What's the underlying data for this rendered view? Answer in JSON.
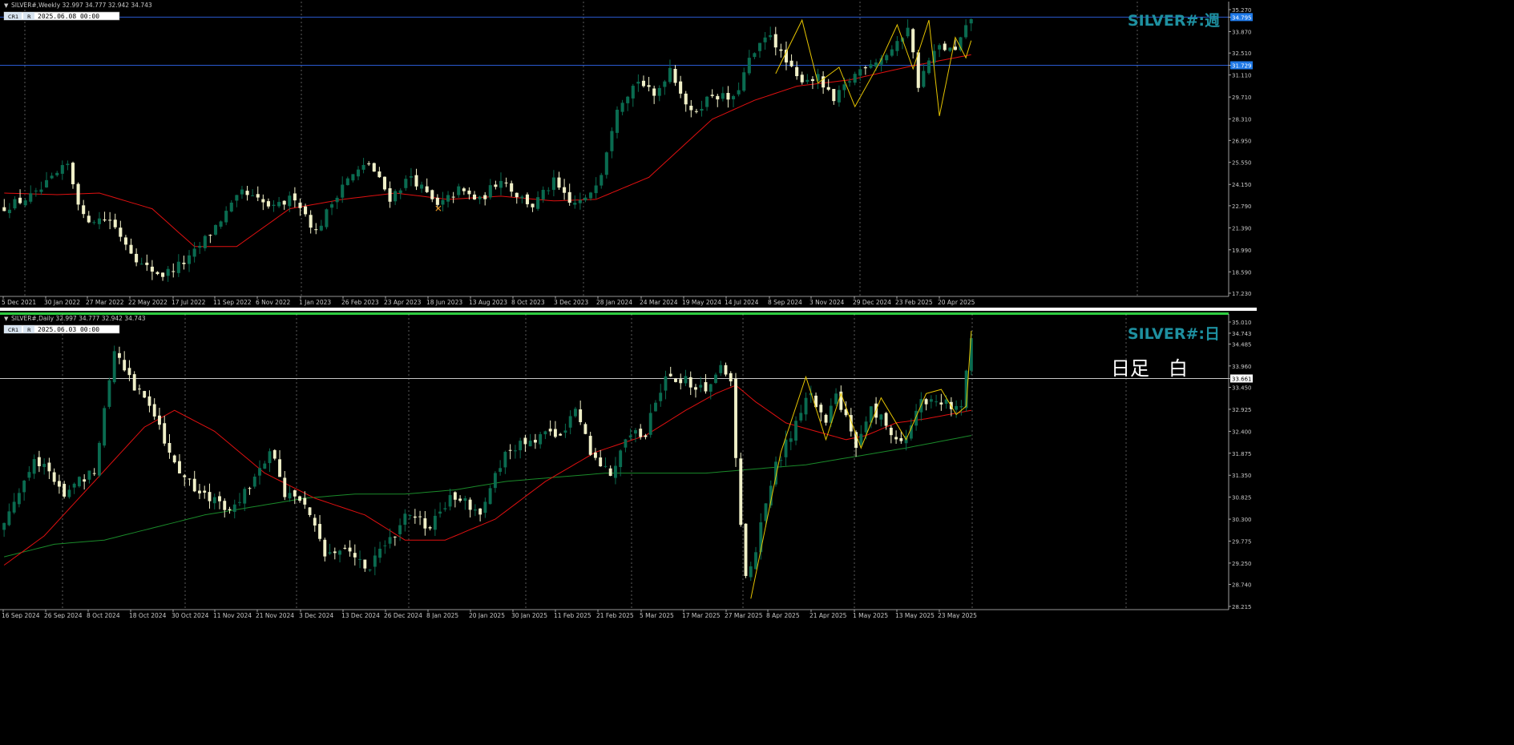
{
  "colors": {
    "background": "#000000",
    "bull_candle": "#0a6b50",
    "bear_candle": "#f0f0c8",
    "ma_short": "#e01010",
    "ma_long": "#1a8a2a",
    "zigzag": "#e6c400",
    "title": "#1e90a0",
    "hline_weekly": "#2a5ad0",
    "hline_daily": "#c8c8c8",
    "price_label": "#1e78e6",
    "panel_divider": "#2ecc40",
    "grid": "#c0c0c0",
    "text": "#c8c8c8"
  },
  "chart_data": [
    {
      "type": "candlestick",
      "symbol_header": "SILVER#,Weekly  32.997 34.777 32.942 34.743",
      "title": "SILVER#:週",
      "toolbar": {
        "cr1": "CR1",
        "r": "R",
        "datetime": "2025.06.08 00:00"
      },
      "ylim": [
        17.23,
        35.27
      ],
      "y_ticks": [
        "35.270",
        "34.795",
        "33.870",
        "32.510",
        "31.729",
        "31.110",
        "29.710",
        "28.310",
        "26.950",
        "25.550",
        "24.150",
        "22.790",
        "21.390",
        "19.990",
        "18.590",
        "17.230"
      ],
      "horizontal_lines": [
        {
          "value": 34.795,
          "label": "34.795"
        },
        {
          "value": 31.729,
          "label": "31.729"
        }
      ],
      "current_price": "34.795",
      "x_labels": [
        "5 Dec 2021",
        "30 Jan 2022",
        "27 Mar 2022",
        "22 May 2022",
        "17 Jul 2022",
        "11 Sep 2022",
        "6 Nov 2022",
        "1 Jan 2023",
        "26 Feb 2023",
        "23 Apr 2023",
        "18 Jun 2023",
        "13 Aug 2023",
        "8 Oct 2023",
        "3 Dec 2023",
        "28 Jan 2024",
        "24 Mar 2024",
        "19 May 2024",
        "14 Jul 2024",
        "8 Sep 2024",
        "3 Nov 2024",
        "29 Dec 2024",
        "23 Feb 2025",
        "20 Apr 2025"
      ],
      "close_anchors": [
        [
          0,
          22.7
        ],
        [
          6,
          23.5
        ],
        [
          12,
          25.4
        ],
        [
          15,
          22.0
        ],
        [
          20,
          21.9
        ],
        [
          26,
          19.0
        ],
        [
          30,
          18.4
        ],
        [
          35,
          19.4
        ],
        [
          40,
          21.5
        ],
        [
          45,
          23.6
        ],
        [
          51,
          22.6
        ],
        [
          55,
          23.4
        ],
        [
          59,
          21.1
        ],
        [
          64,
          24.2
        ],
        [
          69,
          25.5
        ],
        [
          73,
          23.3
        ],
        [
          77,
          24.7
        ],
        [
          82,
          22.7
        ],
        [
          86,
          23.8
        ],
        [
          90,
          23.1
        ],
        [
          94,
          24.6
        ],
        [
          97,
          23.5
        ],
        [
          100,
          22.8
        ],
        [
          104,
          24.3
        ],
        [
          107,
          22.9
        ],
        [
          110,
          23.1
        ],
        [
          113,
          25.0
        ],
        [
          116,
          29.2
        ],
        [
          120,
          30.8
        ],
        [
          123,
          29.7
        ],
        [
          126,
          31.6
        ],
        [
          130,
          28.6
        ],
        [
          134,
          29.9
        ],
        [
          138,
          29.5
        ],
        [
          141,
          32.0
        ],
        [
          145,
          33.8
        ],
        [
          147,
          32.4
        ],
        [
          150,
          30.9
        ],
        [
          154,
          30.9
        ],
        [
          157,
          29.4
        ],
        [
          160,
          30.8
        ],
        [
          163,
          31.8
        ],
        [
          166,
          32.2
        ],
        [
          169,
          33.0
        ],
        [
          171,
          34.3
        ],
        [
          173,
          30.5
        ],
        [
          175,
          32.0
        ],
        [
          177,
          32.9
        ],
        [
          180,
          32.6
        ],
        [
          183,
          34.743
        ]
      ],
      "ma_anchors": [
        [
          0,
          23.6
        ],
        [
          10,
          23.5
        ],
        [
          18,
          23.6
        ],
        [
          28,
          22.6
        ],
        [
          36,
          20.2
        ],
        [
          44,
          20.2
        ],
        [
          54,
          22.6
        ],
        [
          64,
          23.2
        ],
        [
          74,
          23.6
        ],
        [
          84,
          23.2
        ],
        [
          94,
          23.4
        ],
        [
          104,
          23.1
        ],
        [
          112,
          23.2
        ],
        [
          122,
          24.6
        ],
        [
          134,
          28.3
        ],
        [
          142,
          29.5
        ],
        [
          150,
          30.4
        ],
        [
          160,
          30.8
        ],
        [
          172,
          31.7
        ],
        [
          183,
          32.4
        ]
      ],
      "zigzag": [
        [
          146,
          31.2
        ],
        [
          151,
          34.6
        ],
        [
          154,
          30.6
        ],
        [
          158,
          31.6
        ],
        [
          161,
          29.1
        ],
        [
          166,
          32.1
        ],
        [
          169,
          34.3
        ],
        [
          172,
          31.5
        ],
        [
          175,
          34.6
        ],
        [
          177,
          28.5
        ],
        [
          180,
          33.5
        ],
        [
          182,
          32.2
        ],
        [
          183,
          33.3
        ]
      ],
      "marker": {
        "index": 82,
        "value": 22.6,
        "symbol": "✕"
      }
    },
    {
      "type": "candlestick",
      "symbol_header": "SILVER#,Daily  32.997 34.777 32.942 34.743",
      "title": "SILVER#:日",
      "annotation": "日足　白",
      "toolbar": {
        "cr1": "CR1",
        "r": "R",
        "datetime": "2025.06.03 00:00"
      },
      "ylim": [
        28.215,
        35.01
      ],
      "y_ticks": [
        "35.010",
        "34.743",
        "34.485",
        "33.960",
        "33.661",
        "33.450",
        "32.925",
        "32.400",
        "31.875",
        "31.350",
        "30.825",
        "30.300",
        "29.775",
        "29.250",
        "28.740",
        "28.215"
      ],
      "horizontal_lines": [
        {
          "value": 33.661,
          "label": "33.661"
        }
      ],
      "current_price": "34.743",
      "x_labels": [
        "16 Sep 2024",
        "26 Sep 2024",
        "8 Oct 2024",
        "18 Oct 2024",
        "30 Oct 2024",
        "11 Nov 2024",
        "21 Nov 2024",
        "3 Dec 2024",
        "13 Dec 2024",
        "26 Dec 2024",
        "8 Jan 2025",
        "20 Jan 2025",
        "30 Jan 2025",
        "11 Feb 2025",
        "21 Feb 2025",
        "5 Mar 2025",
        "17 Mar 2025",
        "27 Mar 2025",
        "8 Apr 2025",
        "21 Apr 2025",
        "1 May 2025",
        "13 May 2025",
        "23 May 2025"
      ],
      "close_anchors": [
        [
          0,
          30.2
        ],
        [
          6,
          31.8
        ],
        [
          12,
          30.9
        ],
        [
          18,
          31.5
        ],
        [
          22,
          34.4
        ],
        [
          26,
          33.5
        ],
        [
          30,
          32.8
        ],
        [
          35,
          31.4
        ],
        [
          40,
          30.8
        ],
        [
          45,
          30.6
        ],
        [
          50,
          31.2
        ],
        [
          53,
          32.0
        ],
        [
          56,
          30.9
        ],
        [
          60,
          30.7
        ],
        [
          64,
          29.4
        ],
        [
          68,
          29.7
        ],
        [
          72,
          29.1
        ],
        [
          76,
          29.6
        ],
        [
          80,
          30.4
        ],
        [
          85,
          30.1
        ],
        [
          90,
          30.9
        ],
        [
          95,
          30.5
        ],
        [
          100,
          31.8
        ],
        [
          105,
          32.2
        ],
        [
          110,
          32.3
        ],
        [
          114,
          32.8
        ],
        [
          118,
          31.7
        ],
        [
          121,
          31.4
        ],
        [
          124,
          32.2
        ],
        [
          128,
          32.4
        ],
        [
          132,
          33.8
        ],
        [
          136,
          33.6
        ],
        [
          140,
          33.3
        ],
        [
          143,
          34.1
        ],
        [
          145,
          33.5
        ],
        [
          147,
          30.1
        ],
        [
          148,
          28.9
        ],
        [
          150,
          29.6
        ],
        [
          154,
          31.6
        ],
        [
          158,
          32.6
        ],
        [
          161,
          33.3
        ],
        [
          164,
          32.6
        ],
        [
          166,
          33.2
        ],
        [
          170,
          32.1
        ],
        [
          173,
          33.0
        ],
        [
          176,
          32.5
        ],
        [
          179,
          32.1
        ],
        [
          182,
          32.9
        ],
        [
          185,
          33.3
        ],
        [
          188,
          33.1
        ],
        [
          191,
          33.0
        ],
        [
          193,
          34.743
        ]
      ],
      "ma_short_anchors": [
        [
          0,
          29.2
        ],
        [
          8,
          29.9
        ],
        [
          18,
          31.2
        ],
        [
          28,
          32.5
        ],
        [
          34,
          32.9
        ],
        [
          42,
          32.4
        ],
        [
          52,
          31.4
        ],
        [
          62,
          30.8
        ],
        [
          72,
          30.4
        ],
        [
          80,
          29.8
        ],
        [
          88,
          29.8
        ],
        [
          98,
          30.3
        ],
        [
          108,
          31.2
        ],
        [
          118,
          31.9
        ],
        [
          128,
          32.3
        ],
        [
          136,
          32.9
        ],
        [
          142,
          33.3
        ],
        [
          146,
          33.5
        ],
        [
          150,
          33.1
        ],
        [
          156,
          32.6
        ],
        [
          162,
          32.4
        ],
        [
          168,
          32.2
        ],
        [
          172,
          32.3
        ],
        [
          178,
          32.6
        ],
        [
          184,
          32.7
        ],
        [
          193,
          32.9
        ]
      ],
      "ma_long_anchors": [
        [
          0,
          29.4
        ],
        [
          10,
          29.7
        ],
        [
          20,
          29.8
        ],
        [
          30,
          30.1
        ],
        [
          40,
          30.4
        ],
        [
          50,
          30.6
        ],
        [
          60,
          30.8
        ],
        [
          70,
          30.9
        ],
        [
          80,
          30.9
        ],
        [
          90,
          31.0
        ],
        [
          100,
          31.2
        ],
        [
          110,
          31.3
        ],
        [
          120,
          31.4
        ],
        [
          130,
          31.4
        ],
        [
          140,
          31.4
        ],
        [
          150,
          31.5
        ],
        [
          160,
          31.6
        ],
        [
          170,
          31.8
        ],
        [
          180,
          32.0
        ],
        [
          193,
          32.3
        ]
      ],
      "zigzag": [
        [
          149,
          28.4
        ],
        [
          155,
          31.9
        ],
        [
          160,
          33.7
        ],
        [
          164,
          32.2
        ],
        [
          167,
          33.3
        ],
        [
          171,
          32.0
        ],
        [
          175,
          33.2
        ],
        [
          180,
          32.2
        ],
        [
          184,
          33.3
        ],
        [
          187,
          33.4
        ],
        [
          190,
          32.8
        ],
        [
          192,
          33.0
        ],
        [
          193,
          34.8
        ]
      ]
    }
  ]
}
